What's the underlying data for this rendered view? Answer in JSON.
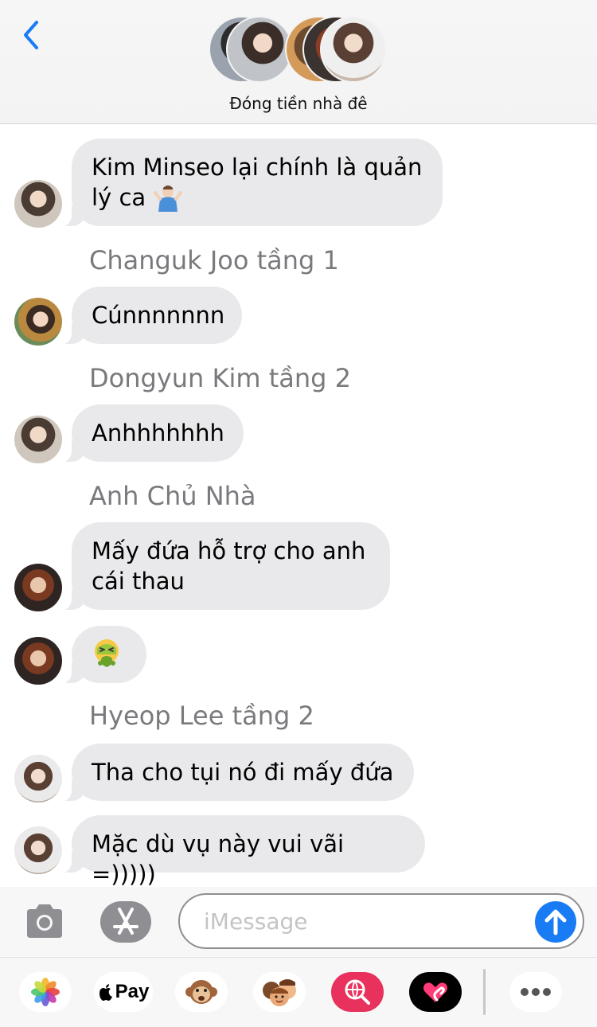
{
  "header": {
    "group_name": "Đóng tiền nhà đê"
  },
  "messages": {
    "m1": {
      "text_line1": "Kim Minseo lại chính là quản",
      "text_line2": "lý ca"
    },
    "m2": {
      "sender": "Changuk Joo tầng 1",
      "text": "Cúnnnnnnn"
    },
    "m3": {
      "sender": "Dongyun Kim tầng 2",
      "text": "Anhhhhhhh"
    },
    "m4": {
      "sender": "Anh Chủ Nhà",
      "text_line1": "Mấy đứa hỗ trợ cho anh",
      "text_line2": "cái thau"
    },
    "m6": {
      "sender": "Hyeop Lee tầng 2",
      "text": "Tha cho tụi nó đi mấy đứa"
    },
    "m7": {
      "text": "Mặc dù vụ này vui vãi =)))))"
    }
  },
  "input": {
    "placeholder": "iMessage"
  },
  "drawer": {
    "pay_label": "Pay",
    "icons": [
      "photos-icon",
      "apple-pay-icon",
      "animoji-icon",
      "memoji-icon",
      "image-search-icon",
      "digital-touch-icon",
      "more-icon"
    ]
  },
  "colors": {
    "accent": "#1a7cf5",
    "bubble": "#e9e9eb",
    "sender_text": "#7a7a7e"
  }
}
